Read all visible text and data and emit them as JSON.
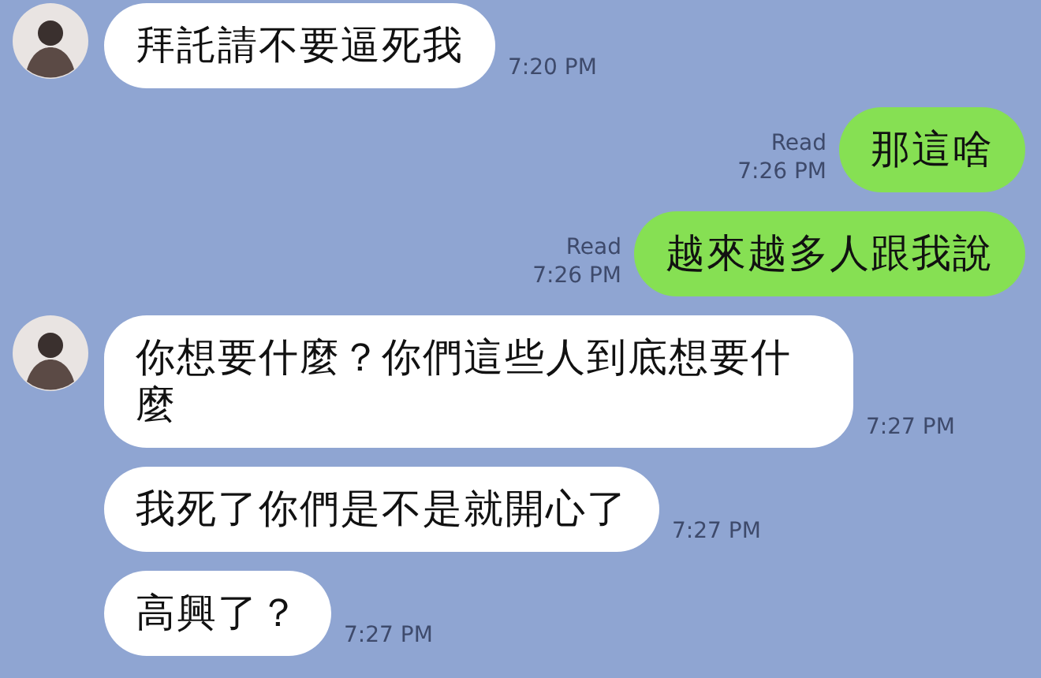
{
  "messages": [
    {
      "kind": "incoming",
      "avatar": true,
      "text": "拜託請不要逼死我",
      "time": "7:20 PM"
    },
    {
      "kind": "outgoing",
      "status": "Read",
      "text": "那這啥",
      "time": "7:26 PM"
    },
    {
      "kind": "outgoing",
      "status": "Read",
      "text": "越來越多人跟我說",
      "time": "7:26 PM"
    },
    {
      "kind": "incoming",
      "avatar": true,
      "text": "你想要什麼？你們這些人到底想要什麼",
      "time": "7:27 PM"
    },
    {
      "kind": "incoming",
      "avatar": false,
      "text": "我死了你們是不是就開心了",
      "time": "7:27 PM"
    },
    {
      "kind": "incoming",
      "avatar": false,
      "text": "高興了？",
      "time": "7:27 PM"
    }
  ]
}
